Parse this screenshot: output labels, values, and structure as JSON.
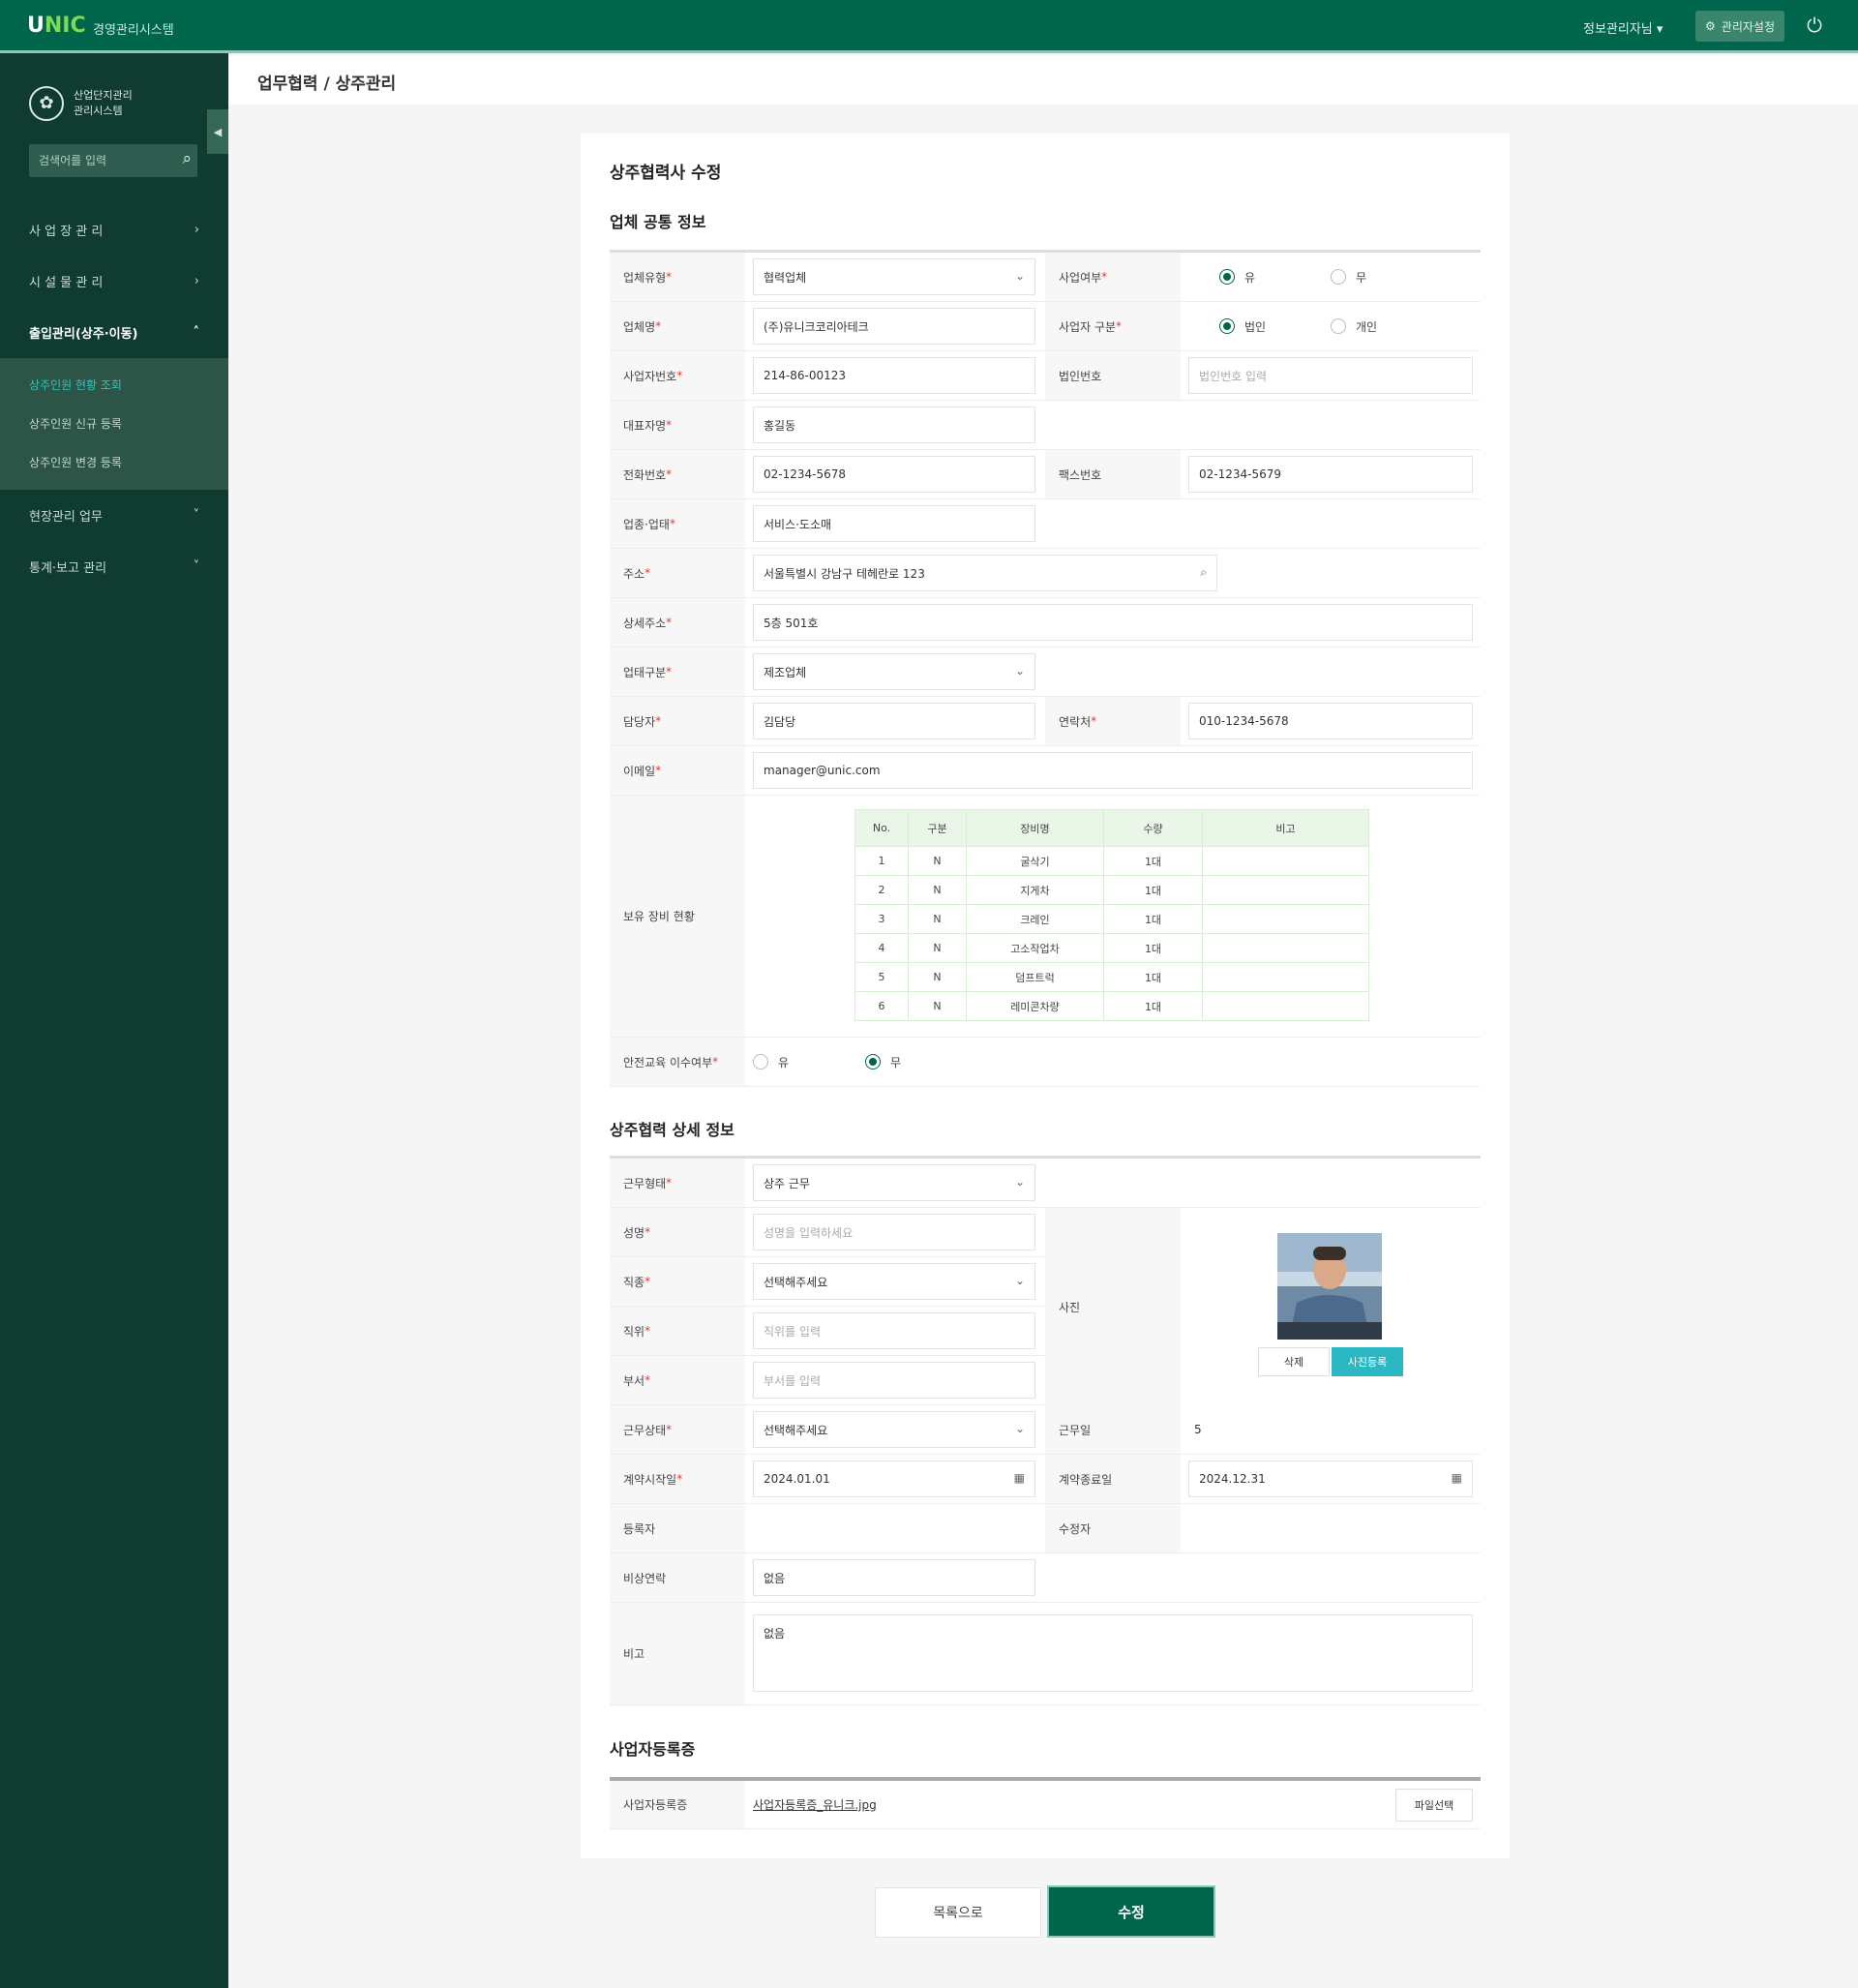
{
  "header": {
    "logo_main": "U",
    "logo_accent": "NIC",
    "logo_sub": "경영관리시스템",
    "user_menu": "정보관리자님 ▾",
    "admin_button": "관리자설정",
    "logout": "⏻"
  },
  "sidebar": {
    "brand_line1": "산업단지관리",
    "brand_line2": "관리시스템",
    "search_placeholder": "검색어를 입력",
    "items": [
      {
        "label": "사 업 장 관 리",
        "arrow": "›"
      },
      {
        "label": "시 설 물 관 리",
        "arrow": "›"
      },
      {
        "label": "출입관리(상주·이동)",
        "arrow": "˄"
      },
      {
        "label": "현장관리 업무",
        "arrow": "˅"
      },
      {
        "label": "통계·보고 관리",
        "arrow": "˅"
      }
    ],
    "subitems": [
      "상주인원 현황 조회",
      "상주인원 신규 등록",
      "상주인원 변경 등록"
    ]
  },
  "breadcrumb": "업무협력 / 상주관리",
  "card": {
    "title": "상주협력사 수정",
    "section1": "업체 공통 정보",
    "section2": "상주협력 상세 정보",
    "section3": "사업자등록증",
    "fields": {
      "company_type_label": "업체유형",
      "company_type_value": "협력업체",
      "ownership_label": "사업여부",
      "ownership_yes": "유",
      "ownership_no": "무",
      "company_name_label": "업체명",
      "company_name_value": "(주)유니크코리아테크",
      "biz_type_label": "사업자 구분",
      "biz_type_corp": "법인",
      "biz_type_indiv": "개인",
      "biz_no_label": "사업자번호",
      "biz_no_value": "214-86-00123",
      "corp_no_label": "법인번호",
      "corp_no_placeholder": "법인번호 입력",
      "ceo_label": "대표자명",
      "ceo_value": "홍길동",
      "phone_label": "전화번호",
      "phone_value": "02-1234-5678",
      "fax_label": "팩스번호",
      "fax_value": "02-1234-5679",
      "license_label": "업종·업태",
      "license_value": "서비스·도소매",
      "address_label": "주소",
      "address_value": "서울특별시 강남구 테헤란로 123",
      "address_detail_label": "상세주소",
      "address_detail_value": "5층 501호",
      "category_label": "업태구분",
      "category_value": "제조업체",
      "manager_label": "담당자",
      "manager_value": "김담당",
      "manager_phone_label": "연락처",
      "manager_phone_value": "010-1234-5678",
      "email_label": "이메일",
      "email_value": "manager@unic.com",
      "equipment_label": "보유 장비 현황",
      "equipment_columns": [
        "No.",
        "구분",
        "장비명",
        "수량",
        "비고"
      ],
      "equipment_rows": [
        [
          "1",
          "N",
          "굴삭기",
          "1대",
          ""
        ],
        [
          "2",
          "N",
          "지게차",
          "1대",
          ""
        ],
        [
          "3",
          "N",
          "크레인",
          "1대",
          ""
        ],
        [
          "4",
          "N",
          "고소작업차",
          "1대",
          ""
        ],
        [
          "5",
          "N",
          "덤프트럭",
          "1대",
          ""
        ],
        [
          "6",
          "N",
          "레미콘차량",
          "1대",
          ""
        ]
      ],
      "safety_label": "안전교육 이수여부",
      "safety_yes": "유",
      "safety_no": "무",
      "worker_type_label": "근무형태",
      "worker_type_value": "상주 근무",
      "worker_name_label": "성명",
      "worker_name_placeholder": "성명을 입력하세요",
      "work_type_label": "직종",
      "work_type_value": "선택해주세요",
      "position_label": "직위",
      "position_placeholder": "직위를 입력",
      "dept_label": "부서",
      "dept_placeholder": "부서를 입력",
      "photo_label": "사진",
      "photo_delete": "삭제",
      "photo_register": "사진등록",
      "status_label": "근무상태",
      "status_value": "선택해주세요",
      "work_days_label": "근무일",
      "work_days_value": "5",
      "start_label": "계약시작일",
      "start_value": "2024.01.01",
      "end_label": "계약종료일",
      "end_value": "2024.12.31",
      "reg_label": "등록자",
      "reg_value": "",
      "mod_label": "수정자",
      "mod_value": "",
      "contact_label": "비상연락",
      "contact_value": "없음",
      "note_label": "비고",
      "note_value": "없음",
      "biz_file_label": "사업자등록증",
      "biz_file_name": "사업자등록증_유니크.jpg",
      "biz_file_button": "파일선택"
    }
  },
  "buttons": {
    "list": "목록으로",
    "save": "수정"
  },
  "colors": {
    "primary": "#00664b",
    "sidebar": "#0f3b30",
    "accent_teal": "#2bb8c4",
    "required": "#e53935"
  }
}
